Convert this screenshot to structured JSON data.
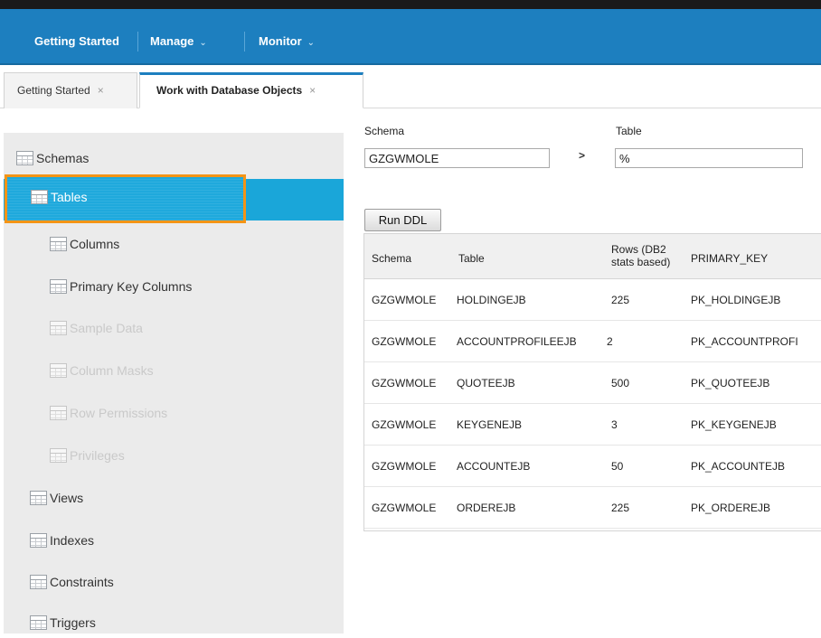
{
  "nav": {
    "items": [
      {
        "label": "Getting Started"
      },
      {
        "label": "Manage",
        "caret": "⌄"
      },
      {
        "label": "Monitor",
        "caret": "⌄"
      }
    ]
  },
  "tabs": [
    {
      "label": "Getting Started",
      "close": "×"
    },
    {
      "label": "Work with Database Objects",
      "close": "×"
    }
  ],
  "sidebar": {
    "items": [
      {
        "label": "Schemas",
        "icon": "table-icon"
      },
      {
        "label": "Tables",
        "icon": "table-icon",
        "selected": true
      },
      {
        "label": "Columns",
        "icon": "table-icon"
      },
      {
        "label": "Primary Key Columns",
        "icon": "table-icon"
      },
      {
        "label": "Sample Data",
        "icon": "table-icon",
        "disabled": true
      },
      {
        "label": "Column Masks",
        "icon": "table-icon",
        "disabled": true
      },
      {
        "label": "Row Permissions",
        "icon": "table-icon",
        "disabled": true
      },
      {
        "label": "Privileges",
        "icon": "table-icon",
        "disabled": true
      },
      {
        "label": "Views",
        "icon": "table-icon"
      },
      {
        "label": "Indexes",
        "icon": "table-icon"
      },
      {
        "label": "Constraints",
        "icon": "table-icon"
      },
      {
        "label": "Triggers",
        "icon": "table-icon"
      }
    ]
  },
  "filter": {
    "schema_label": "Schema",
    "schema_value": "GZGWMOLE",
    "separator": ">",
    "table_label": "Table",
    "table_value": "%"
  },
  "actions": {
    "run_ddl": "Run DDL"
  },
  "grid": {
    "headers": {
      "schema": "Schema",
      "table": "Table",
      "rows_line1": "Rows (DB2",
      "rows_line2": "stats based)",
      "primary_key": "PRIMARY_KEY"
    },
    "rows": [
      {
        "schema": "GZGWMOLE",
        "table": "HOLDINGEJB",
        "rows": "225",
        "primary_key": "PK_HOLDINGEJB"
      },
      {
        "schema": "GZGWMOLE",
        "table": "ACCOUNTPROFILEEJB",
        "rows": "2",
        "primary_key": "PK_ACCOUNTPROFI"
      },
      {
        "schema": "GZGWMOLE",
        "table": "QUOTEEJB",
        "rows": "500",
        "primary_key": "PK_QUOTEEJB"
      },
      {
        "schema": "GZGWMOLE",
        "table": "KEYGENEJB",
        "rows": "3",
        "primary_key": "PK_KEYGENEJB"
      },
      {
        "schema": "GZGWMOLE",
        "table": "ACCOUNTEJB",
        "rows": "50",
        "primary_key": "PK_ACCOUNTEJB"
      },
      {
        "schema": "GZGWMOLE",
        "table": "ORDEREJB",
        "rows": "225",
        "primary_key": "PK_ORDEREJB"
      }
    ]
  },
  "colors": {
    "nav_blue": "#1d7fbf",
    "selection_blue": "#1aa6d9",
    "highlight_orange": "#f49416"
  }
}
